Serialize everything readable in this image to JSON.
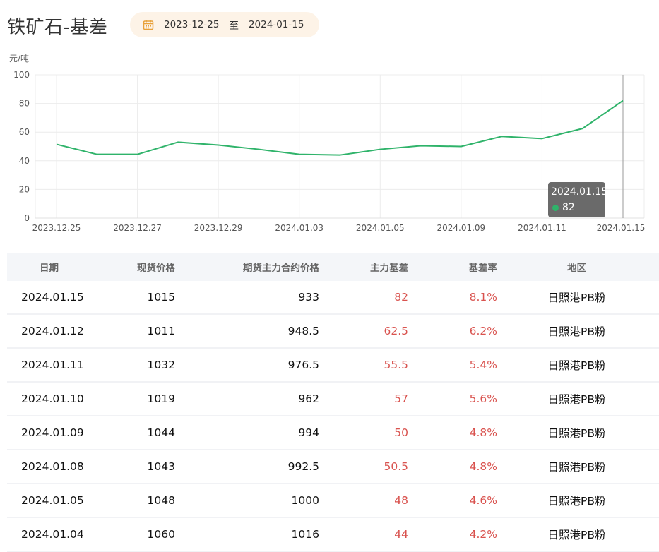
{
  "header": {
    "title": "铁矿石-基差",
    "date_from": "2023-12-25",
    "date_sep": "至",
    "date_to": "2024-01-15"
  },
  "chart_data": {
    "type": "line",
    "ylabel": "元/吨",
    "ylim": [
      0,
      100
    ],
    "yticks": [
      "0",
      "20",
      "40",
      "60",
      "80",
      "100"
    ],
    "x_tick_labels": [
      "2023.12.25",
      "2023.12.27",
      "2023.12.29",
      "2024.01.03",
      "2024.01.05",
      "2024.01.09",
      "2024.01.11",
      "2024.01.15"
    ],
    "x": [
      "2023.12.25",
      "2023.12.26",
      "2023.12.27",
      "2023.12.28",
      "2023.12.29",
      "2024.01.02",
      "2024.01.03",
      "2024.01.04",
      "2024.01.05",
      "2024.01.08",
      "2024.01.09",
      "2024.01.10",
      "2024.01.11",
      "2024.01.12",
      "2024.01.15"
    ],
    "values": [
      51.5,
      44.5,
      44.5,
      53,
      51,
      48,
      44.5,
      44,
      48,
      50.5,
      50,
      57,
      55.5,
      62.5,
      82
    ],
    "grid": true,
    "line_color": "#2fb36a",
    "tooltip": {
      "date": "2024.01.15",
      "value": "82"
    }
  },
  "table": {
    "headers": [
      "日期",
      "现货价格",
      "期货主力合约价格",
      "主力基差",
      "基差率",
      "地区"
    ],
    "rows": [
      [
        "2024.01.15",
        "1015",
        "933",
        "82",
        "8.1%",
        "日照港PB粉"
      ],
      [
        "2024.01.12",
        "1011",
        "948.5",
        "62.5",
        "6.2%",
        "日照港PB粉"
      ],
      [
        "2024.01.11",
        "1032",
        "976.5",
        "55.5",
        "5.4%",
        "日照港PB粉"
      ],
      [
        "2024.01.10",
        "1019",
        "962",
        "57",
        "5.6%",
        "日照港PB粉"
      ],
      [
        "2024.01.09",
        "1044",
        "994",
        "50",
        "4.8%",
        "日照港PB粉"
      ],
      [
        "2024.01.08",
        "1043",
        "992.5",
        "50.5",
        "4.8%",
        "日照港PB粉"
      ],
      [
        "2024.01.05",
        "1048",
        "1000",
        "48",
        "4.6%",
        "日照港PB粉"
      ],
      [
        "2024.01.04",
        "1060",
        "1016",
        "44",
        "4.2%",
        "日照港PB粉"
      ]
    ]
  },
  "colors": {
    "accent_red": "#d9534f",
    "date_pill_bg": "#fdf3e7",
    "calendar_icon": "#e8a13a"
  }
}
